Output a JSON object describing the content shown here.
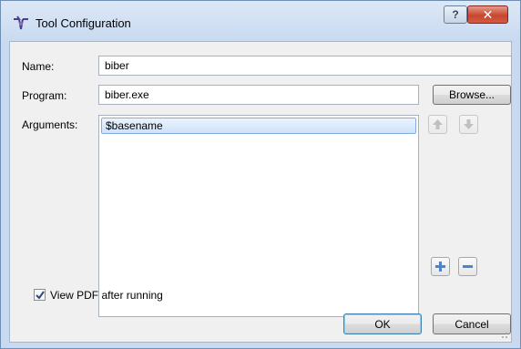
{
  "window": {
    "title": "Tool Configuration",
    "help_label": "?",
    "close_label": "✕"
  },
  "form": {
    "name_label": "Name:",
    "name_value": "biber",
    "program_label": "Program:",
    "program_value": "biber.exe",
    "browse_label": "Browse...",
    "arguments_label": "Arguments:",
    "arguments": [
      "$basename"
    ]
  },
  "options": {
    "view_pdf_label": "View PDF after running",
    "view_pdf_checked": true
  },
  "buttons": {
    "ok_label": "OK",
    "cancel_label": "Cancel"
  },
  "icons": {
    "move_up": "arrow-up-icon",
    "move_down": "arrow-down-icon",
    "add": "plus-icon",
    "remove": "minus-icon"
  },
  "colors": {
    "selection": "#cfe3fb",
    "default_button_border": "#3c7fb1"
  }
}
